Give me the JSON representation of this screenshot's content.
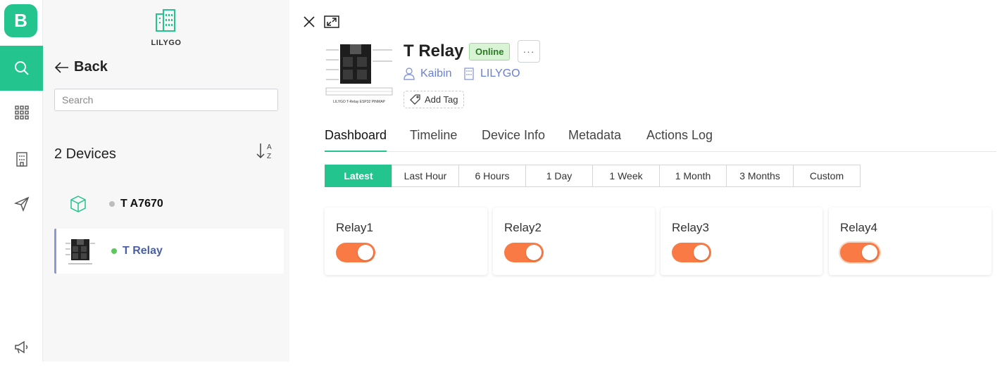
{
  "brand": {
    "logo_letter": "B",
    "accent": "#23c48e"
  },
  "rail": {
    "items": [
      {
        "icon": "search-icon"
      },
      {
        "icon": "grid-icon"
      },
      {
        "icon": "building-icon"
      },
      {
        "icon": "send-icon"
      },
      {
        "icon": "megaphone-icon"
      }
    ]
  },
  "sidebar": {
    "org_name": "LILYGO",
    "back_label": "Back",
    "search_placeholder": "Search",
    "device_count": "2 Devices",
    "sort_label_a": "A",
    "sort_label_z": "Z",
    "devices": [
      {
        "name": "T A7670",
        "status": "offline",
        "status_color": "#bdbdbd"
      },
      {
        "name": "T Relay",
        "status": "online",
        "status_color": "#5cc85c"
      }
    ]
  },
  "device": {
    "title": "T Relay",
    "status_badge": "Online",
    "more_label": "···",
    "owner": "Kaibin",
    "organization": "LILYGO",
    "add_tag_label": "Add Tag",
    "image_caption": "LILYGO T-Relay ESP32 PINMAP"
  },
  "tabs": [
    "Dashboard",
    "Timeline",
    "Device Info",
    "Metadata",
    "Actions Log"
  ],
  "active_tab": "Dashboard",
  "time_ranges": [
    "Latest",
    "Last Hour",
    "6 Hours",
    "1 Day",
    "1 Week",
    "1 Month",
    "3 Months",
    "Custom"
  ],
  "active_range": "Latest",
  "widgets": [
    {
      "label": "Relay1",
      "on": true
    },
    {
      "label": "Relay2",
      "on": true
    },
    {
      "label": "Relay3",
      "on": true
    },
    {
      "label": "Relay4",
      "on": true
    }
  ],
  "colors": {
    "switch_on": "#f97a44",
    "online_badge_bg": "#d9f3d5",
    "link": "#6a7fd0"
  }
}
